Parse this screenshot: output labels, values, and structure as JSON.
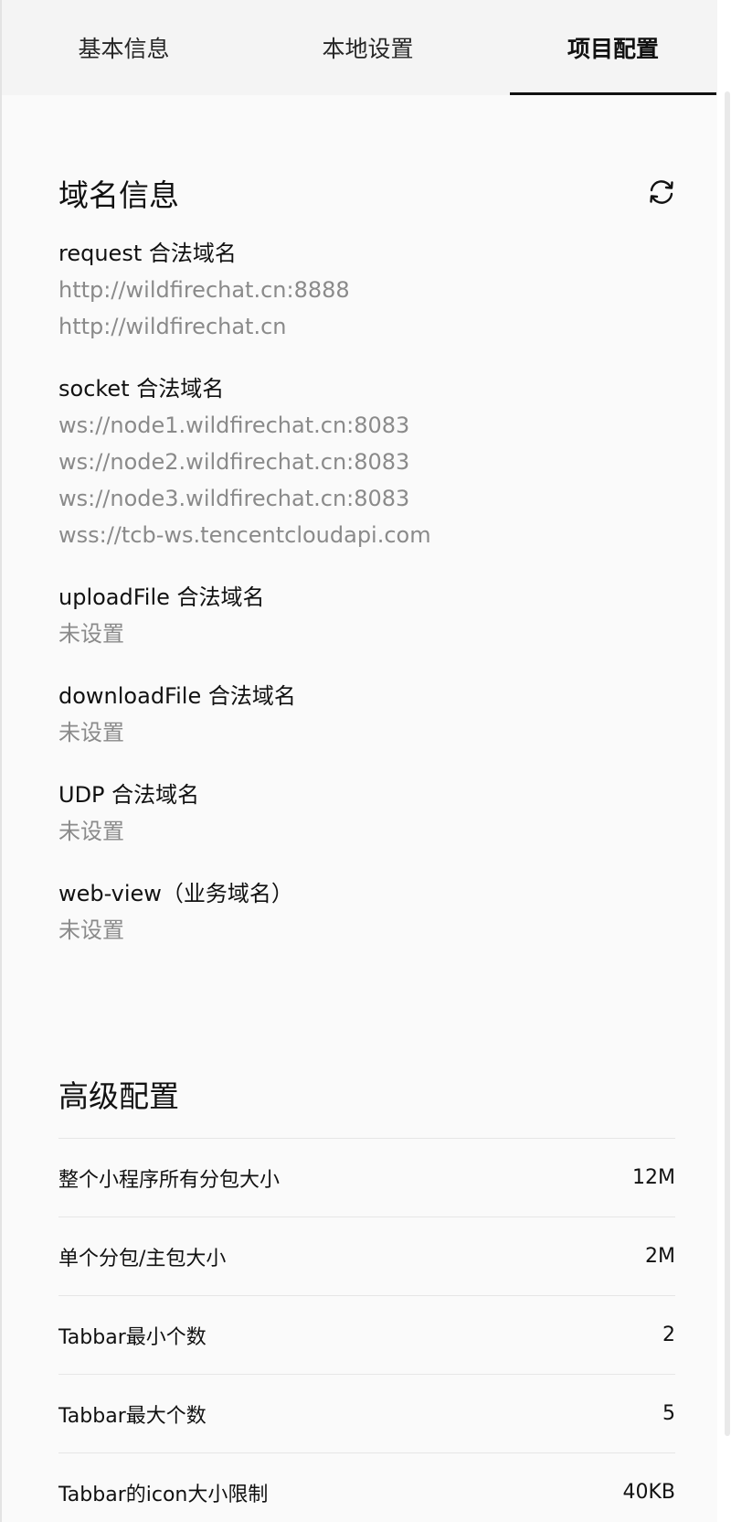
{
  "tabs": [
    {
      "label": "基本信息",
      "active": false
    },
    {
      "label": "本地设置",
      "active": false
    },
    {
      "label": "项目配置",
      "active": true
    }
  ],
  "domain_info": {
    "title": "域名信息",
    "refresh_icon": "refresh-icon",
    "groups": [
      {
        "label": "request 合法域名",
        "values": [
          "http://wildfirechat.cn:8888",
          "http://wildfirechat.cn"
        ]
      },
      {
        "label": "socket 合法域名",
        "values": [
          "ws://node1.wildfirechat.cn:8083",
          "ws://node2.wildfirechat.cn:8083",
          "ws://node3.wildfirechat.cn:8083",
          "wss://tcb-ws.tencentcloudapi.com"
        ]
      },
      {
        "label": "uploadFile 合法域名",
        "values": [
          "未设置"
        ]
      },
      {
        "label": "downloadFile 合法域名",
        "values": [
          "未设置"
        ]
      },
      {
        "label": "UDP 合法域名",
        "values": [
          "未设置"
        ]
      },
      {
        "label": "web-view（业务域名）",
        "values": [
          "未设置"
        ]
      }
    ]
  },
  "advanced": {
    "title": "高级配置",
    "rows": [
      {
        "label": "整个小程序所有分包大小",
        "value": "12M"
      },
      {
        "label": "单个分包/主包大小",
        "value": "2M"
      },
      {
        "label": "Tabbar最小个数",
        "value": "2"
      },
      {
        "label": "Tabbar最大个数",
        "value": "5"
      },
      {
        "label": "Tabbar的icon大小限制",
        "value": "40KB"
      }
    ]
  },
  "colors": {
    "active_tab_underline": "#111111",
    "muted_text": "#8a8a8a",
    "panel_bg": "#fafafa",
    "tabbar_bg": "#f4f4f4"
  }
}
